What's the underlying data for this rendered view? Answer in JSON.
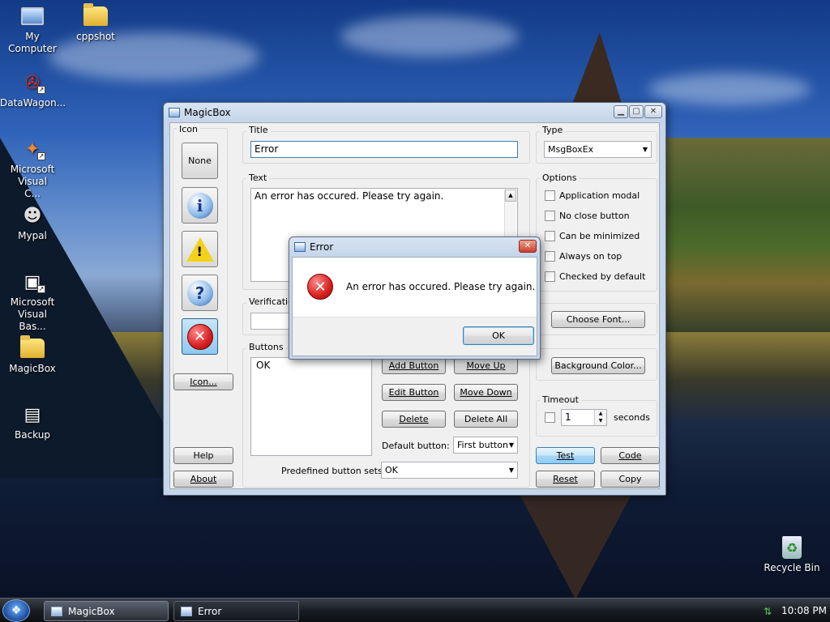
{
  "desktop": {
    "icons": [
      {
        "label": "My Computer"
      },
      {
        "label": "cppshot"
      },
      {
        "label": "DataWagon..."
      },
      {
        "label": "Microsoft Visual C..."
      },
      {
        "label": "Mypal"
      },
      {
        "label": "Microsoft Visual Bas..."
      },
      {
        "label": "MagicBox"
      },
      {
        "label": "Backup"
      },
      {
        "label": "Recycle Bin"
      }
    ]
  },
  "magicbox": {
    "title": "MagicBox",
    "icon_group": {
      "label": "Icon",
      "none_label": "None",
      "icon_button_label": "Icon...",
      "help_label": "Help",
      "about_label": "About"
    },
    "title_group": {
      "label": "Title",
      "value": "Error"
    },
    "text_group": {
      "label": "Text",
      "value": "An error has occured. Please try again."
    },
    "verification_group": {
      "label": "Verificatio"
    },
    "buttons_group": {
      "label": "Buttons",
      "list": [
        "OK"
      ],
      "add_label": "Add Button",
      "move_up_label": "Move Up",
      "edit_label": "Edit Button",
      "move_down_label": "Move Down",
      "delete_label": "Delete",
      "delete_all_label": "Delete All",
      "default_button_label": "Default button:",
      "default_button_value": "First button",
      "predefined_label": "Predefined button sets:",
      "predefined_value": "OK"
    },
    "type_group": {
      "label": "Type",
      "value": "MsgBoxEx"
    },
    "options_group": {
      "label": "Options",
      "items": [
        "Application modal",
        "No close button",
        "Can be minimized",
        "Always on top",
        "Checked by default"
      ]
    },
    "choose_font_label": "Choose Font...",
    "background_color_label": "Background Color...",
    "timeout_group": {
      "label": "Timeout",
      "value": "1",
      "unit": "seconds"
    },
    "test_label": "Test",
    "code_label": "Code",
    "reset_label": "Reset",
    "copy_label": "Copy"
  },
  "error_dialog": {
    "title": "Error",
    "message": "An error has occured. Please try again.",
    "ok_label": "OK"
  },
  "taskbar": {
    "tasks": [
      "MagicBox",
      "Error"
    ],
    "clock": "10:08 PM"
  },
  "colors": {
    "accent": "#3c7fb1",
    "error_red": "#d82020",
    "taskbar": "#1a1e24"
  }
}
